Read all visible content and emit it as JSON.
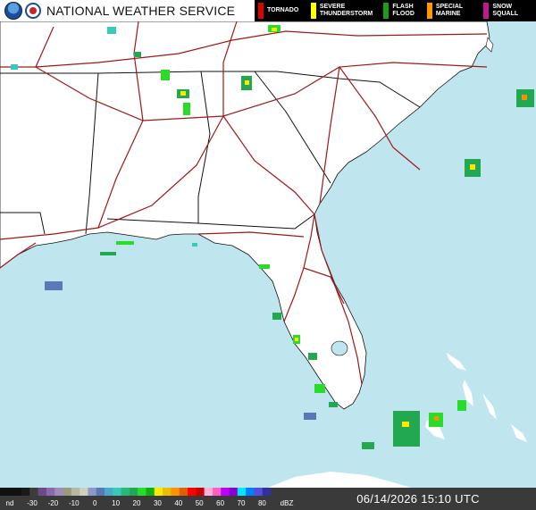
{
  "header": {
    "agency": "NATIONAL WEATHER SERVICE",
    "logos": [
      "noaa-logo",
      "nws-logo"
    ]
  },
  "warnings_legend": [
    {
      "label": "TORNADO",
      "color": "#e00000"
    },
    {
      "label": "SEVERE\nTHUNDERSTORM",
      "color": "#ffff00"
    },
    {
      "label": "FLASH\nFLOOD",
      "color": "#1a9e1a"
    },
    {
      "label": "SPECIAL\nMARINE",
      "color": "#ff9900"
    },
    {
      "label": "SNOW\nSQUALL",
      "color": "#c0188f"
    }
  ],
  "reflectivity_scale": {
    "unit": "dBZ",
    "nd_label": "nd",
    "ticks": [
      "-30",
      "-20",
      "-10",
      "0",
      "10",
      "20",
      "30",
      "40",
      "50",
      "60",
      "70",
      "80"
    ],
    "colors": [
      "#1a1a1a",
      "#3d3d3d",
      "#6b4a8a",
      "#8a6aaa",
      "#a08cb8",
      "#9a9a80",
      "#b8b8a0",
      "#cfcfc0",
      "#8a9ac8",
      "#5a78b4",
      "#4aa8c8",
      "#3ac8b8",
      "#2ab878",
      "#22a850",
      "#2adc2a",
      "#10b010",
      "#ffe800",
      "#e8c000",
      "#ff9000",
      "#e06000",
      "#ff0000",
      "#c80000",
      "#ffb0d8",
      "#ff60c0",
      "#c000ff",
      "#8a00d0",
      "#00e8ff",
      "#0080ff",
      "#5050e0",
      "#3030a0"
    ]
  },
  "map": {
    "ocean_color": "#bfe6ef",
    "land_color": "#ffffff",
    "road_color": "#a01818"
  },
  "timestamp": "06/14/2026 15:10 UTC"
}
